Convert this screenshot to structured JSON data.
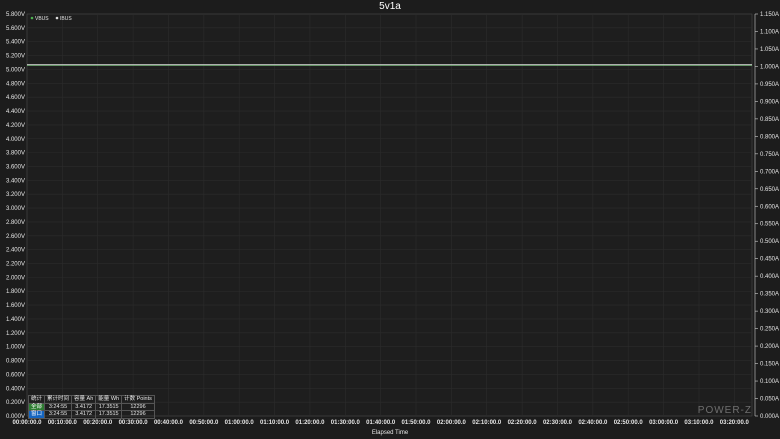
{
  "chart_data": {
    "type": "line",
    "title": "5v1a",
    "xlabel": "Elapsed Time",
    "x_ticks": [
      "00:00:00.0",
      "00:10:00.0",
      "00:20:00.0",
      "00:30:00.0",
      "00:40:00.0",
      "00:50:00.0",
      "01:00:00.0",
      "01:10:00.0",
      "01:20:00.0",
      "01:30:00.0",
      "01:40:00.0",
      "01:50:00.0",
      "02:00:00.0",
      "02:10:00.0",
      "02:20:00.0",
      "02:30:00.0",
      "02:40:00.0",
      "02:50:00.0",
      "03:00:00.0",
      "03:10:00.0",
      "03:20:00.0"
    ],
    "x_minutes_range": [
      0,
      205
    ],
    "y_left": {
      "min": 0,
      "max": 5.8,
      "step": 0.2,
      "tick_labels": [
        "0.000V",
        "0.200V",
        "0.400V",
        "0.600V",
        "0.800V",
        "1.000V",
        "1.200V",
        "1.400V",
        "1.600V",
        "1.800V",
        "2.000V",
        "2.200V",
        "2.400V",
        "2.600V",
        "2.800V",
        "3.000V",
        "3.200V",
        "3.400V",
        "3.600V",
        "3.800V",
        "4.000V",
        "4.200V",
        "4.400V",
        "4.600V",
        "4.800V",
        "5.000V",
        "5.200V",
        "5.400V",
        "5.600V",
        "5.800V"
      ]
    },
    "y_right": {
      "min": 0,
      "max": 1.15,
      "step": 0.05,
      "tick_labels": [
        "0.000A",
        "0.050A",
        "0.100A",
        "0.150A",
        "0.200A",
        "0.250A",
        "0.300A",
        "0.350A",
        "0.400A",
        "0.450A",
        "0.500A",
        "0.550A",
        "0.600A",
        "0.650A",
        "0.700A",
        "0.750A",
        "0.800A",
        "0.850A",
        "0.900A",
        "0.950A",
        "1.000A",
        "1.050A",
        "1.100A",
        "1.150A"
      ]
    },
    "grid": true,
    "legend_position": "top-left",
    "series": [
      {
        "name": "VBUS",
        "axis": "left",
        "color": "#4caf50",
        "x": [
          0,
          205
        ],
        "values": [
          5.06,
          5.06
        ]
      },
      {
        "name": "IBUS",
        "axis": "right",
        "color": "#dddddd",
        "x": [
          0,
          205
        ],
        "values": [
          1.005,
          1.005
        ]
      }
    ]
  },
  "stats": {
    "headers": [
      "统计",
      "累计时间",
      "容量 Ah",
      "能量 Wh",
      "计数 Points"
    ],
    "rows": [
      [
        "全部",
        "3:24:55",
        "3.4172",
        "17.3515",
        "12296"
      ],
      [
        "窗口",
        "3:24:55",
        "3.4172",
        "17.3515",
        "12296"
      ]
    ]
  },
  "watermark": "POWER-Z"
}
